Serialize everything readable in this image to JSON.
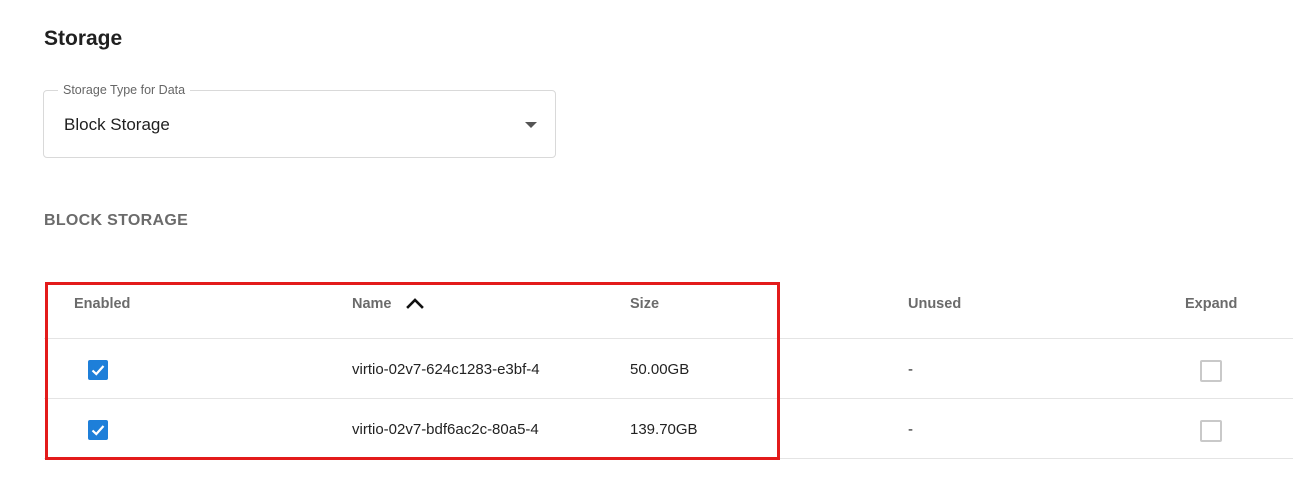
{
  "section": {
    "title": "Storage"
  },
  "storage_type": {
    "label": "Storage Type for Data",
    "value": "Block Storage"
  },
  "block_storage": {
    "title": "BLOCK STORAGE",
    "columns": {
      "enabled": "Enabled",
      "name": "Name",
      "size": "Size",
      "unused": "Unused",
      "expand": "Expand"
    },
    "sort": {
      "column": "name",
      "direction": "ascending",
      "icon": "arrow-up-icon"
    },
    "rows": [
      {
        "enabled": true,
        "name": "virtio-02v7-624c1283-e3bf-4",
        "size": "50.00GB",
        "unused": "-",
        "expand": false
      },
      {
        "enabled": true,
        "name": "virtio-02v7-bdf6ac2c-80a5-4",
        "size": "139.70GB",
        "unused": "-",
        "expand": false
      }
    ]
  },
  "colors": {
    "accent": "#1e7fd9",
    "highlight": "#e31b1b"
  }
}
